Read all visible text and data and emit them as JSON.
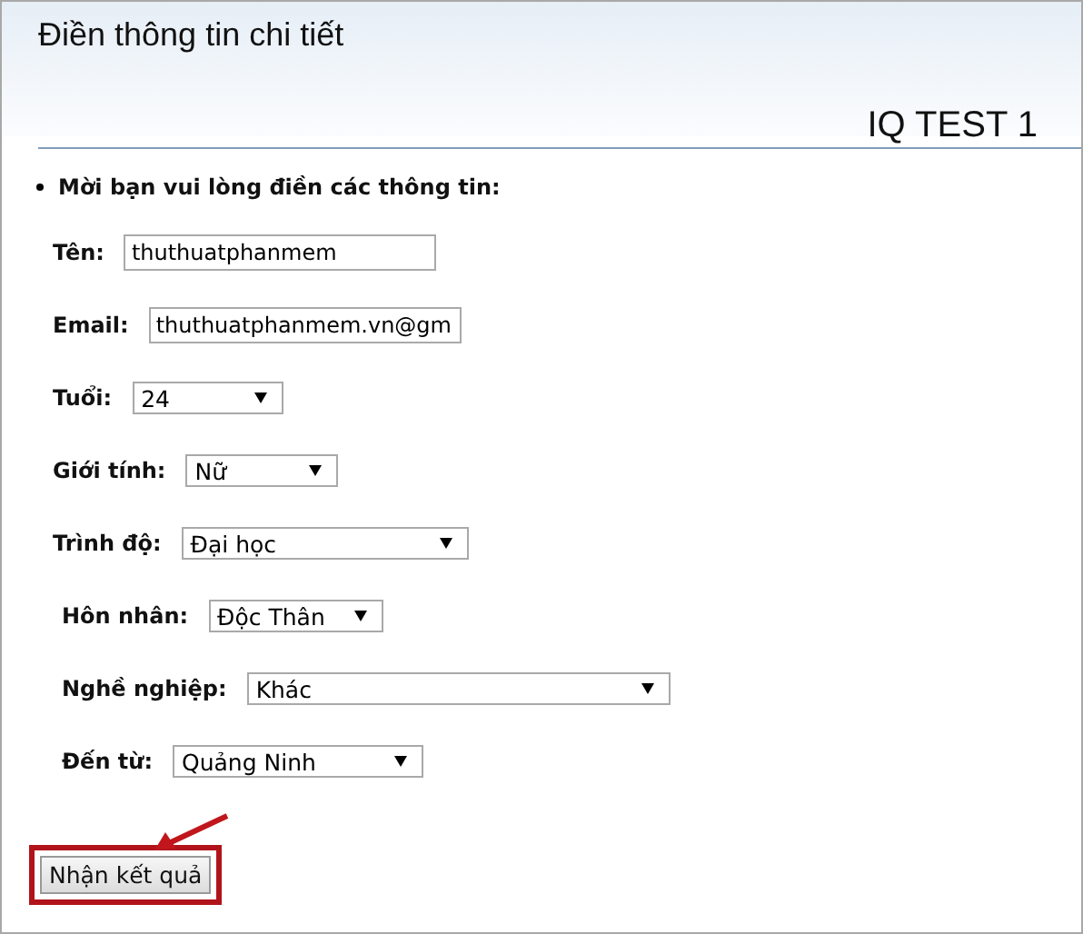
{
  "header": {
    "title": "Điền thông tin chi tiết",
    "subtitle": "IQ TEST 1"
  },
  "intro": "Mời bạn vui lòng điền các thông tin:",
  "fields": [
    {
      "label": "Tên:",
      "kind": "text",
      "value": "thuthuatphanmem"
    },
    {
      "label": "Email:",
      "kind": "text",
      "value": "thuthuatphanmem.vn@gm"
    },
    {
      "label": "Tuổi:",
      "kind": "select",
      "value": "24"
    },
    {
      "label": "Giới tính:",
      "kind": "select",
      "value": "Nữ"
    },
    {
      "label": "Trình độ:",
      "kind": "select",
      "value": "Đại học"
    },
    {
      "label": "Hôn nhân:",
      "kind": "select",
      "value": "Độc Thân"
    },
    {
      "label": "Nghề nghiệp:",
      "kind": "select",
      "value": "Khác"
    },
    {
      "label": "Đến từ:",
      "kind": "select",
      "value": "Quảng Ninh"
    }
  ],
  "submit": {
    "label": "Nhận kết quả",
    "highlighted": true
  }
}
